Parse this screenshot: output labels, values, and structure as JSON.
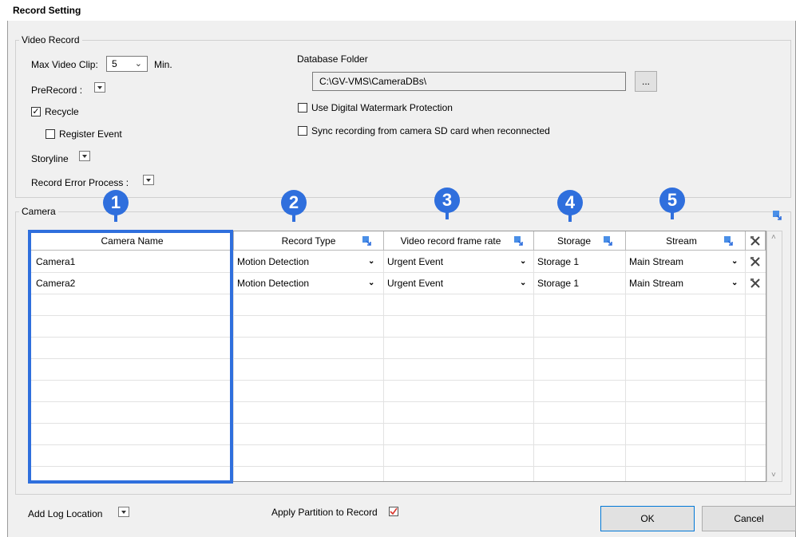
{
  "window": {
    "title": "Record Setting"
  },
  "video_record": {
    "group_label": "Video Record",
    "max_clip_label": "Max Video Clip:",
    "max_clip_value": "5",
    "max_clip_unit": "Min.",
    "prerecord_label": "PreRecord :",
    "recycle_label": "Recycle",
    "recycle_checked": true,
    "register_event_label": "Register Event",
    "storyline_label": "Storyline",
    "record_error_label": "Record Error Process :",
    "database_folder_label": "Database Folder",
    "database_folder_value": "C:\\GV-VMS\\CameraDBs\\",
    "browse_label": "...",
    "watermark_label": "Use Digital Watermark Protection",
    "sync_sd_label": "Sync recording from camera SD card when reconnected"
  },
  "camera": {
    "group_label": "Camera",
    "columns": [
      "Camera Name",
      "Record Type",
      "Video record frame rate",
      "Storage",
      "Stream"
    ],
    "rows": [
      {
        "name": "Camera1",
        "record_type": "Motion Detection",
        "frame_rate": "Urgent Event",
        "storage": "Storage 1",
        "stream": "Main Stream"
      },
      {
        "name": "Camera2",
        "record_type": "Motion Detection",
        "frame_rate": "Urgent Event",
        "storage": "Storage 1",
        "stream": "Main Stream"
      }
    ]
  },
  "callouts": [
    "1",
    "2",
    "3",
    "4",
    "5"
  ],
  "footer": {
    "add_log_label": "Add Log Location",
    "apply_partition_label": "Apply Partition to Record",
    "apply_partition_checked": true,
    "ok_label": "OK",
    "cancel_label": "Cancel"
  },
  "colors": {
    "accent": "#2f6fdd",
    "checkmark": "#d9342b",
    "dialog_bg": "#f0f0f0"
  },
  "icons": [
    "apply-to-all-icon",
    "tools-icon",
    "dropdown-arrow-icon",
    "chevron-down-icon",
    "checkmark-icon"
  ]
}
